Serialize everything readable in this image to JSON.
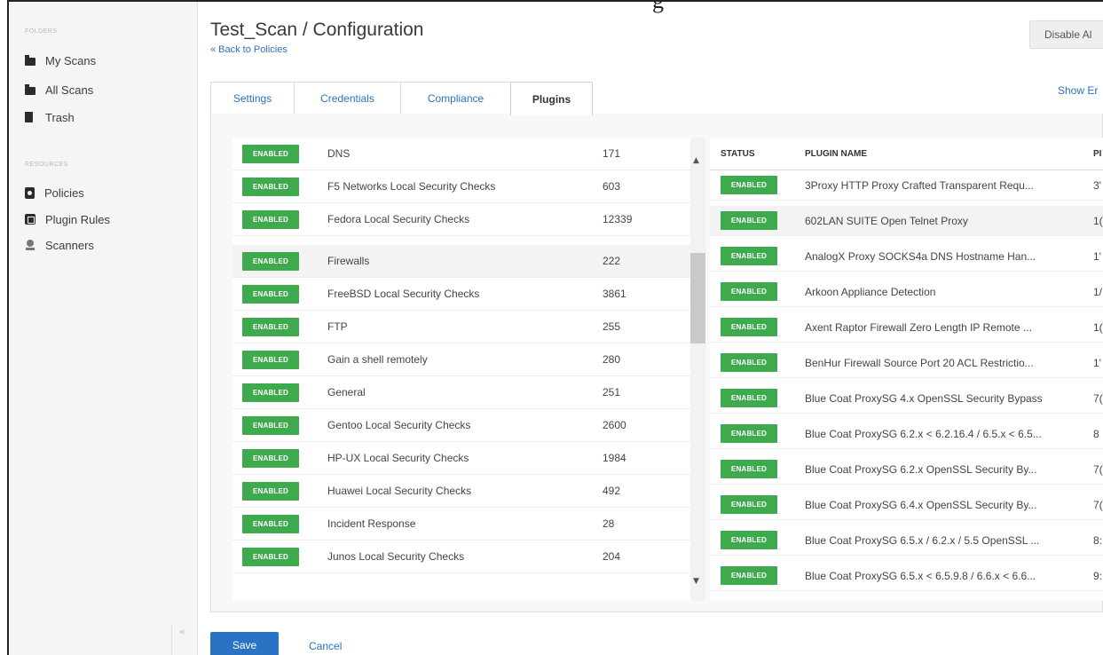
{
  "window": {
    "title_fragment": "g"
  },
  "sidebar": {
    "folders_header": "FOLDERS",
    "folders": [
      {
        "label": "My Scans",
        "icon": "folder-icon"
      },
      {
        "label": "All Scans",
        "icon": "folder-icon"
      },
      {
        "label": "Trash",
        "icon": "trash-icon"
      }
    ],
    "resources_header": "RESOURCES",
    "resources": [
      {
        "label": "Policies",
        "icon": "policy-icon"
      },
      {
        "label": "Plugin Rules",
        "icon": "plugin-rules-icon"
      },
      {
        "label": "Scanners",
        "icon": "scanner-icon"
      }
    ],
    "collapse_glyph": "«"
  },
  "header": {
    "title": "Test_Scan / Configuration",
    "back_link": "« Back to Policies",
    "disable_button": "Disable Al",
    "show_link": "Show Er"
  },
  "tabs": [
    {
      "label": "Settings",
      "active": false
    },
    {
      "label": "Credentials",
      "active": false
    },
    {
      "label": "Compliance",
      "active": false
    },
    {
      "label": "Plugins",
      "active": true
    }
  ],
  "families": [
    {
      "status": "ENABLED",
      "name": "DNS",
      "count": "171"
    },
    {
      "status": "ENABLED",
      "name": "F5 Networks Local Security Checks",
      "count": "603"
    },
    {
      "status": "ENABLED",
      "name": "Fedora Local Security Checks",
      "count": "12339"
    },
    {
      "status": "ENABLED",
      "name": "Firewalls",
      "count": "222"
    },
    {
      "status": "ENABLED",
      "name": "FreeBSD Local Security Checks",
      "count": "3861"
    },
    {
      "status": "ENABLED",
      "name": "FTP",
      "count": "255"
    },
    {
      "status": "ENABLED",
      "name": "Gain a shell remotely",
      "count": "280"
    },
    {
      "status": "ENABLED",
      "name": "General",
      "count": "251"
    },
    {
      "status": "ENABLED",
      "name": "Gentoo Local Security Checks",
      "count": "2600"
    },
    {
      "status": "ENABLED",
      "name": "HP-UX Local Security Checks",
      "count": "1984"
    },
    {
      "status": "ENABLED",
      "name": "Huawei Local Security Checks",
      "count": "492"
    },
    {
      "status": "ENABLED",
      "name": "Incident Response",
      "count": "28"
    },
    {
      "status": "ENABLED",
      "name": "Junos Local Security Checks",
      "count": "204"
    }
  ],
  "plugin_table": {
    "columns": [
      "STATUS",
      "PLUGIN NAME",
      "PI"
    ],
    "rows": [
      {
        "status": "ENABLED",
        "name": "3Proxy HTTP Proxy Crafted Transparent Requ...",
        "id": "3'"
      },
      {
        "status": "ENABLED",
        "name": "602LAN SUITE Open Telnet Proxy",
        "id": "1("
      },
      {
        "status": "ENABLED",
        "name": "AnalogX Proxy SOCKS4a DNS Hostname Han...",
        "id": "1'"
      },
      {
        "status": "ENABLED",
        "name": "Arkoon Appliance Detection",
        "id": "1/"
      },
      {
        "status": "ENABLED",
        "name": "Axent Raptor Firewall Zero Length IP Remote ...",
        "id": "1("
      },
      {
        "status": "ENABLED",
        "name": "BenHur Firewall Source Port 20 ACL Restrictio...",
        "id": "1'"
      },
      {
        "status": "ENABLED",
        "name": "Blue Coat ProxySG 4.x OpenSSL Security Bypass",
        "id": "7("
      },
      {
        "status": "ENABLED",
        "name": "Blue Coat ProxySG 6.2.x < 6.2.16.4 / 6.5.x < 6.5...",
        "id": "8"
      },
      {
        "status": "ENABLED",
        "name": "Blue Coat ProxySG 6.2.x OpenSSL Security By...",
        "id": "7("
      },
      {
        "status": "ENABLED",
        "name": "Blue Coat ProxySG 6.4.x OpenSSL Security By...",
        "id": "7("
      },
      {
        "status": "ENABLED",
        "name": "Blue Coat ProxySG 6.5.x / 6.2.x / 5.5 OpenSSL ...",
        "id": "8:"
      },
      {
        "status": "ENABLED",
        "name": "Blue Coat ProxySG 6.5.x < 6.5.9.8 / 6.6.x < 6.6...",
        "id": "9:"
      }
    ]
  },
  "footer": {
    "save": "Save",
    "cancel": "Cancel"
  },
  "colors": {
    "accent": "#2a72c4",
    "enabled": "#3ea94d"
  }
}
